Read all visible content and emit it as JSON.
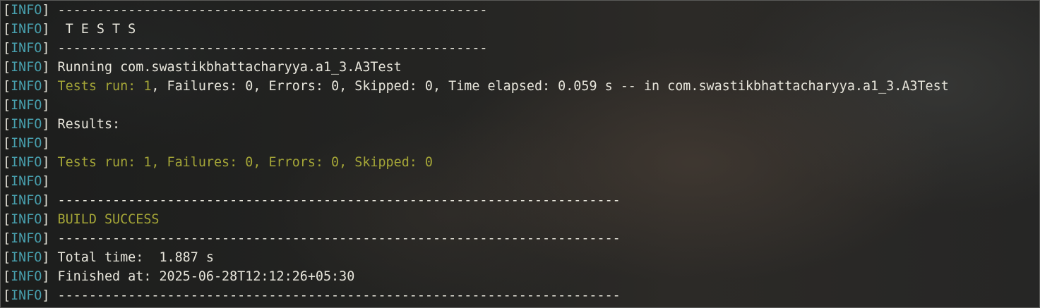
{
  "terminal": {
    "prefix_open": "[",
    "prefix_tag": "INFO",
    "prefix_close": "]",
    "lines": [
      {
        "segments": [
          {
            "text": " -------------------------------------------------------",
            "style": "msg"
          }
        ]
      },
      {
        "segments": [
          {
            "text": "  T E S T S",
            "style": "msg"
          }
        ]
      },
      {
        "segments": [
          {
            "text": " -------------------------------------------------------",
            "style": "msg"
          }
        ]
      },
      {
        "segments": [
          {
            "text": " Running com.swastikbhattacharyya.a1_3.A3Test",
            "style": "msg"
          }
        ]
      },
      {
        "segments": [
          {
            "text": " ",
            "style": "msg"
          },
          {
            "text": "Tests run: 1",
            "style": "hl"
          },
          {
            "text": ", Failures: 0, Errors: 0, Skipped: 0, Time elapsed: 0.059 s -- in com.swastikbhattacharyya.a1_3.A3Test",
            "style": "msg"
          }
        ]
      },
      {
        "segments": [
          {
            "text": "",
            "style": "msg"
          }
        ]
      },
      {
        "segments": [
          {
            "text": " Results:",
            "style": "msg"
          }
        ]
      },
      {
        "segments": [
          {
            "text": "",
            "style": "msg"
          }
        ]
      },
      {
        "segments": [
          {
            "text": " ",
            "style": "msg"
          },
          {
            "text": "Tests run: 1, Failures: 0, Errors: 0, Skipped: 0",
            "style": "ok"
          }
        ]
      },
      {
        "segments": [
          {
            "text": "",
            "style": "msg"
          }
        ]
      },
      {
        "segments": [
          {
            "text": " ------------------------------------------------------------------------",
            "style": "msg"
          }
        ]
      },
      {
        "segments": [
          {
            "text": " ",
            "style": "msg"
          },
          {
            "text": "BUILD SUCCESS",
            "style": "ok"
          }
        ]
      },
      {
        "segments": [
          {
            "text": " ------------------------------------------------------------------------",
            "style": "msg"
          }
        ]
      },
      {
        "segments": [
          {
            "text": " Total time:  1.887 s",
            "style": "msg"
          }
        ]
      },
      {
        "segments": [
          {
            "text": " Finished at: 2025-06-28T12:12:26+05:30",
            "style": "msg"
          }
        ]
      },
      {
        "segments": [
          {
            "text": " ------------------------------------------------------------------------",
            "style": "msg"
          }
        ]
      }
    ]
  },
  "colors": {
    "tag": "#48a0ae",
    "text": "#e8e6dc",
    "highlight": "#a5a637"
  }
}
